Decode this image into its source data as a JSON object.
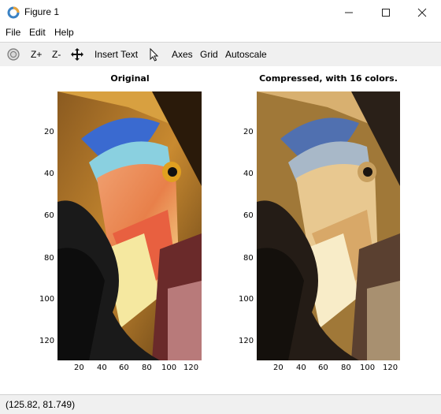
{
  "window": {
    "title": "Figure 1"
  },
  "menu": [
    "File",
    "Edit",
    "Help"
  ],
  "toolbar": {
    "zoom_in": "Z+",
    "zoom_out": "Z-",
    "insert_text": "Insert Text",
    "axes": "Axes",
    "grid": "Grid",
    "autoscale": "Autoscale"
  },
  "plots": [
    {
      "title": "Original",
      "yticks": [
        "20",
        "40",
        "60",
        "80",
        "100",
        "120"
      ],
      "xticks": [
        "20",
        "40",
        "60",
        "80",
        "100",
        "120"
      ]
    },
    {
      "title": "Compressed, with 16 colors.",
      "yticks": [
        "20",
        "40",
        "60",
        "80",
        "100",
        "120"
      ],
      "xticks": [
        "20",
        "40",
        "60",
        "80",
        "100",
        "120"
      ]
    }
  ],
  "status": {
    "coords": "(125.82, 81.749)"
  },
  "icons": [
    "app-icon",
    "minimize-icon",
    "maximize-icon",
    "close-icon",
    "rotate-icon",
    "pan-icon",
    "pointer-icon"
  ]
}
